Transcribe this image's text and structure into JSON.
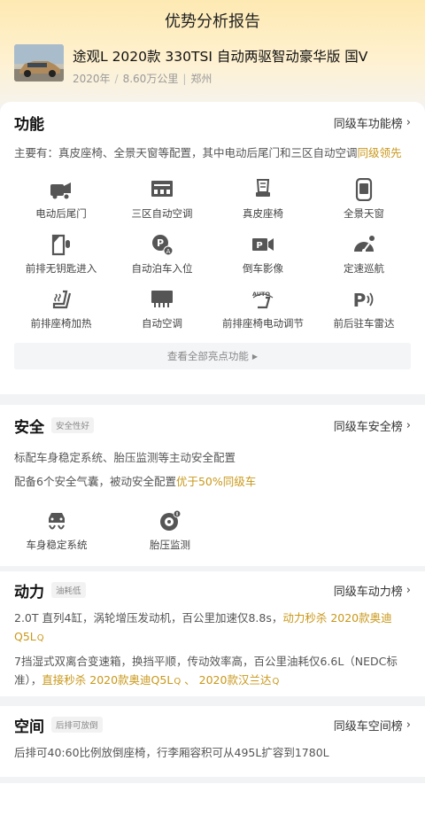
{
  "header": {
    "title": "优势分析报告"
  },
  "car": {
    "name": "途观L 2020款 330TSI 自动两驱智动豪华版 国V",
    "year": "2020年",
    "mileage": "8.60万公里",
    "city": "郑州"
  },
  "function": {
    "title": "功能",
    "rank_link": "同级车功能榜",
    "summary_prefix": "主要有：真皮座椅、全景天窗等配置，其中电动后尾门和三区自动空调",
    "summary_highlight": "同级领先",
    "features": [
      {
        "icon": "power-tailgate-icon",
        "label": "电动后尾门"
      },
      {
        "icon": "tri-zone-ac-icon",
        "label": "三区自动空调"
      },
      {
        "icon": "leather-seat-icon",
        "label": "真皮座椅"
      },
      {
        "icon": "panoramic-sunroof-icon",
        "label": "全景天窗"
      },
      {
        "icon": "keyless-entry-icon",
        "label": "前排无钥匙进入"
      },
      {
        "icon": "auto-parking-icon",
        "label": "自动泊车入位"
      },
      {
        "icon": "reverse-camera-icon",
        "label": "倒车影像"
      },
      {
        "icon": "cruise-control-icon",
        "label": "定速巡航"
      },
      {
        "icon": "seat-heating-icon",
        "label": "前排座椅加热"
      },
      {
        "icon": "auto-ac-icon",
        "label": "自动空调"
      },
      {
        "icon": "power-seat-adjust-icon",
        "label": "前排座椅电动调节"
      },
      {
        "icon": "parking-radar-icon",
        "label": "前后驻车雷达"
      }
    ],
    "view_all": "查看全部亮点功能"
  },
  "safety": {
    "title": "安全",
    "badge": "安全性好",
    "rank_link": "同级车安全榜",
    "line1": "标配车身稳定系统、胎压监测等主动安全配置",
    "line2_prefix": "配备6个安全气囊，被动安全配置",
    "line2_highlight": "优于50%同级车",
    "features": [
      {
        "icon": "stability-control-icon",
        "label": "车身稳定系统"
      },
      {
        "icon": "tire-pressure-icon",
        "label": "胎压监测"
      }
    ]
  },
  "power": {
    "title": "动力",
    "badge": "油耗低",
    "rank_link": "同级车动力榜",
    "line1_prefix": "2.0T 直列4缸，涡轮增压发动机，百公里加速仅8.8s，",
    "line1_highlight": "动力秒杀 2020款奥迪Q5L",
    "line2_prefix": "7挡湿式双离合变速箱，换挡平顺，传动效率高，百公里油耗仅6.6L（NEDC标准），",
    "line2_highlight1": "直接秒杀 2020款奥迪Q5L",
    "line2_sep": " 、 ",
    "line2_highlight2": "2020款汉兰达"
  },
  "space": {
    "title": "空间",
    "badge": "后排可放倒",
    "rank_link": "同级车空间榜",
    "line1": "后排可40:60比例放倒座椅，行李厢容积可从495L扩容到1780L"
  },
  "colors": {
    "accent": "#c9981a",
    "hero_top": "#fde9b2"
  }
}
